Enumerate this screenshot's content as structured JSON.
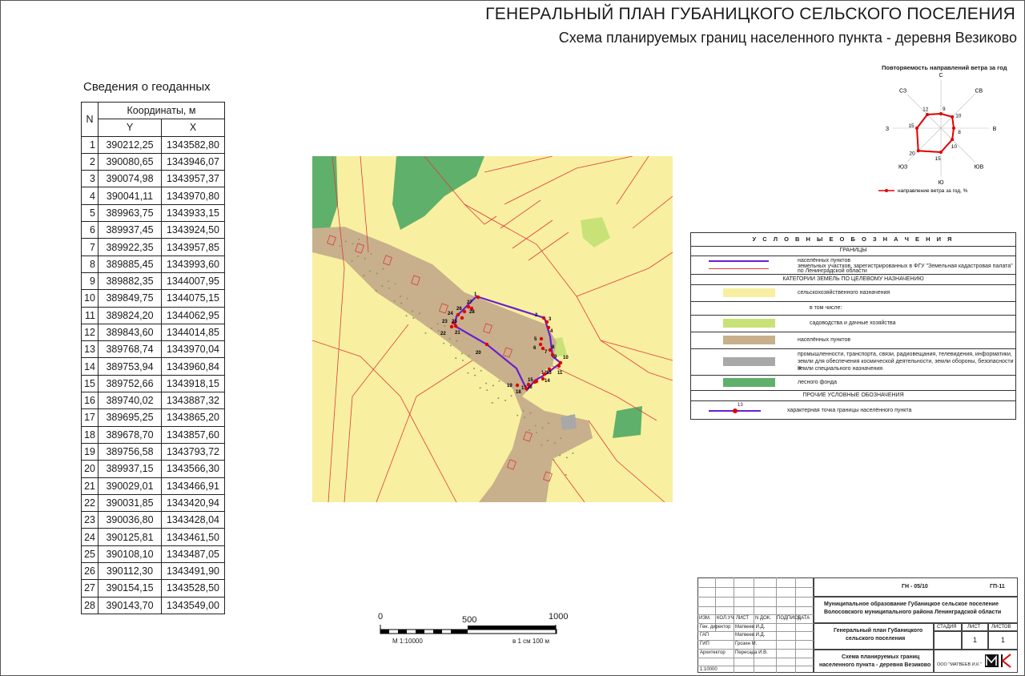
{
  "title": {
    "main": "ГЕНЕРАЛЬНЫЙ ПЛАН ГУБАНИЦКОГО СЕЛЬСКОГО ПОСЕЛЕНИЯ",
    "sub": "Схема планируемых границ населенного пункта - деревня Везиково"
  },
  "geodata": {
    "caption": "Сведения о геоданных",
    "col_n": "N",
    "col_coords": "Координаты, м",
    "col_y": "Y",
    "col_x": "X",
    "rows": [
      {
        "n": "1",
        "y": "390212,25",
        "x": "1343582,80"
      },
      {
        "n": "2",
        "y": "390080,65",
        "x": "1343946,07"
      },
      {
        "n": "3",
        "y": "390074,98",
        "x": "1343957,37"
      },
      {
        "n": "4",
        "y": "390041,11",
        "x": "1343970,80"
      },
      {
        "n": "5",
        "y": "389963,75",
        "x": "1343933,15"
      },
      {
        "n": "6",
        "y": "389937,45",
        "x": "1343924,50"
      },
      {
        "n": "7",
        "y": "389922,35",
        "x": "1343957,85"
      },
      {
        "n": "8",
        "y": "389885,45",
        "x": "1343993,60"
      },
      {
        "n": "9",
        "y": "389882,35",
        "x": "1344007,95"
      },
      {
        "n": "10",
        "y": "389849,75",
        "x": "1344075,15"
      },
      {
        "n": "11",
        "y": "389824,20",
        "x": "1344062,95"
      },
      {
        "n": "12",
        "y": "389843,60",
        "x": "1344014,85"
      },
      {
        "n": "13",
        "y": "389768,74",
        "x": "1343970,04"
      },
      {
        "n": "14",
        "y": "389753,94",
        "x": "1343960,84"
      },
      {
        "n": "15",
        "y": "389752,66",
        "x": "1343918,15"
      },
      {
        "n": "16",
        "y": "389740,02",
        "x": "1343887,32"
      },
      {
        "n": "17",
        "y": "389695,25",
        "x": "1343865,20"
      },
      {
        "n": "18",
        "y": "389678,70",
        "x": "1343857,60"
      },
      {
        "n": "19",
        "y": "389756,58",
        "x": "1343793,72"
      },
      {
        "n": "20",
        "y": "389937,15",
        "x": "1343566,30"
      },
      {
        "n": "21",
        "y": "390029,01",
        "x": "1343466,91"
      },
      {
        "n": "22",
        "y": "390031,85",
        "x": "1343420,94"
      },
      {
        "n": "23",
        "y": "390036,80",
        "x": "1343428,04"
      },
      {
        "n": "24",
        "y": "390125,81",
        "x": "1343461,50"
      },
      {
        "n": "25",
        "y": "390108,10",
        "x": "1343487,05"
      },
      {
        "n": "26",
        "y": "390112,30",
        "x": "1343491,90"
      },
      {
        "n": "27",
        "y": "390154,15",
        "x": "1343528,50"
      },
      {
        "n": "28",
        "y": "390143,70",
        "x": "1343549,00"
      }
    ]
  },
  "map": {
    "boundary_color": "#6a1fd0",
    "point_color": "#e00000",
    "colors": {
      "agricultural": "#f8f0a0",
      "dacha": "#c8e278",
      "settlement": "#c8b08c",
      "industrial": "#a8a8a8",
      "forest": "#5fb06a",
      "parcel_line": "#e03a3a"
    },
    "point_labels": [
      "1",
      "2",
      "3",
      "4",
      "5",
      "6",
      "7",
      "8",
      "9",
      "10",
      "11",
      "12",
      "13",
      "14",
      "15",
      "16",
      "17",
      "18",
      "19",
      "20",
      "21",
      "22",
      "23",
      "24",
      "25",
      "26",
      "27",
      "28"
    ]
  },
  "wind_rose": {
    "title": "Повторяемость направлений ветра за год",
    "directions": [
      "С",
      "СВ",
      "В",
      "ЮВ",
      "Ю",
      "ЮЗ",
      "З",
      "СЗ"
    ],
    "values": [
      9,
      10,
      8,
      10,
      15,
      20,
      15,
      12
    ],
    "line_color": "#e00000",
    "legend": "направление ветра за год, %"
  },
  "legend": {
    "header": "У С Л О В Н Ы Е   О Б О З Н А Ч Е Н И Я",
    "borders_title": "ГРАНИЦЫ",
    "border_settlement": "населённых пунктов",
    "border_parcels": "земельных участков, зарегистрированных в ФГУ \"Земельная кадастровая палата\"",
    "border_parcels_2": "по Ленинградской области",
    "categories_title": "КАТЕГОРИИ ЗЕМЕЛЬ ПО ЦЕЛЕВОМУ НАЗНАЧЕНИЮ",
    "cat_agri": "сельскохозяйственного назначения",
    "cat_including": "в том числе:",
    "cat_dacha": "садоводства и дачные хозяйства",
    "cat_settlement": "населённых пунктов",
    "cat_industrial_1": "промышленности, транспорта, связи, радиовещания, телевидения, информатики,",
    "cat_industrial_2": "земли для обеспечения космической деятельности, земли обороны, безопасности и",
    "cat_industrial_3": "земли специального назначения",
    "cat_forest": "лесного фонда",
    "other_title": "ПРОЧИЕ УСЛОВНЫЕ ОБОЗНАЧЕНИЯ",
    "char_point_label": "13",
    "char_point": "характерная точка границы населённого пункта"
  },
  "scale": {
    "label_0": "0",
    "label_500": "500",
    "label_1000": "1000",
    "ratio": "М 1:10000",
    "note": "в 1 см 100 м"
  },
  "stamp": {
    "code": "ГН - 05/10",
    "sheet_code": "ГП-11",
    "org_1": "Муниципальное образование Губаницкое сельское поселение",
    "org_2": "Волосовского  муниципального района Ленинградской области",
    "col_izm": "ИЗМ.",
    "col_koluch": "КОЛ.УЧ",
    "col_list": "ЛИСТ",
    "col_ndok": "N ДОК.",
    "col_podpis": "ПОДПИСЬ",
    "col_data": "ДАТА",
    "role_1": "Ген. директор",
    "name_1": "Матвеев И.Д.",
    "role_2": "ГАП",
    "name_2": "Матвеев И.Д.",
    "role_3": "ГИП",
    "name_3": "Грозин М.",
    "role_4": "Архитектор",
    "name_4": "Пересада И.В.",
    "project_1": "Генеральный план Губаницкого",
    "project_2": "сельского поселения",
    "stage_h": "СТАДИЯ",
    "list_h": "ЛИСТ",
    "lists_h": "ЛИСТОВ",
    "list_v": "1",
    "lists_v": "1",
    "sheet_title_1": "Схема планируемых границ",
    "sheet_title_2": "населенного пункта - деревня Везиково",
    "company": "ООО \"МАТВЕЕВ И.К.\"",
    "scale": "1:10000"
  }
}
